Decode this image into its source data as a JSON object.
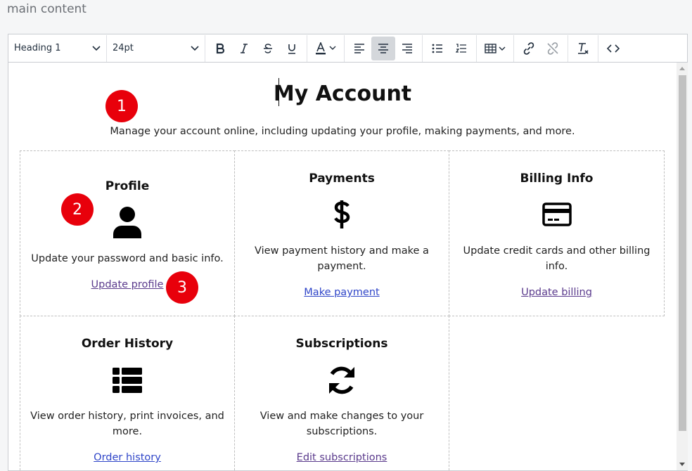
{
  "page": {
    "label": "main content"
  },
  "toolbar": {
    "block_format": "Heading 1",
    "font_size": "24pt"
  },
  "document": {
    "title": "My Account",
    "subtitle": "Manage your account online, including updating your profile, making payments, and more."
  },
  "cards": [
    {
      "title": "Profile",
      "icon": "user-icon",
      "description": "Update your password and basic info.",
      "link": "Update profile"
    },
    {
      "title": "Payments",
      "icon": "dollar-icon",
      "description": "View payment history and make a payment.",
      "link": "Make payment"
    },
    {
      "title": "Billing Info",
      "icon": "credit-card-icon",
      "description": "Update credit cards and other billing info.",
      "link": "Update billing"
    },
    {
      "title": "Order History",
      "icon": "list-icon",
      "description": "View order history, print invoices, and more.",
      "link": "Order history"
    },
    {
      "title": "Subscriptions",
      "icon": "sync-icon",
      "description": "View and make changes to your subscriptions.",
      "link": "Edit subscriptions"
    }
  ],
  "annotations": [
    "1",
    "2",
    "3"
  ],
  "colors": {
    "badge": "#e8000b",
    "link": "#2f45c8",
    "visited_link": "#5a3a8c"
  }
}
